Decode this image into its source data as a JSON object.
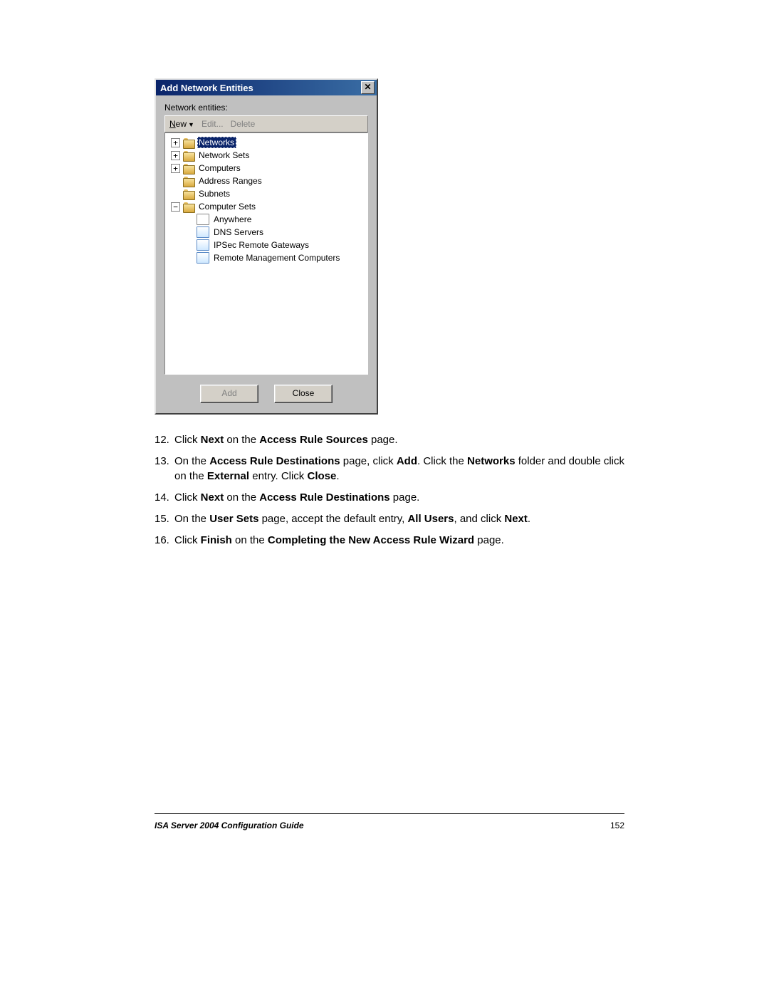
{
  "dialog": {
    "title": "Add Network Entities",
    "label": "Network entities:",
    "toolbar": {
      "new": "New",
      "edit": "Edit...",
      "delete": "Delete"
    },
    "tree": {
      "networks": "Networks",
      "network_sets": "Network Sets",
      "computers": "Computers",
      "address_ranges": "Address Ranges",
      "subnets": "Subnets",
      "computer_sets": "Computer Sets",
      "anywhere": "Anywhere",
      "dns_servers": "DNS Servers",
      "ipsec": "IPSec Remote Gateways",
      "remote_mgmt": "Remote Management Computers"
    },
    "buttons": {
      "add": "Add",
      "close": "Close"
    }
  },
  "steps": {
    "s12_num": "12.",
    "s12_a": "Click ",
    "s12_b": "Next",
    "s12_c": " on the ",
    "s12_d": "Access Rule Sources",
    "s12_e": " page.",
    "s13_num": "13.",
    "s13_a": "On the ",
    "s13_b": "Access Rule Destinations",
    "s13_c": " page, click ",
    "s13_d": "Add",
    "s13_e": ". Click the ",
    "s13_f": "Networks",
    "s13_g": " folder and double click on the ",
    "s13_h": "External",
    "s13_i": " entry. Click ",
    "s13_j": "Close",
    "s13_k": ".",
    "s14_num": "14.",
    "s14_a": "Click ",
    "s14_b": "Next",
    "s14_c": " on the ",
    "s14_d": "Access Rule Destinations",
    "s14_e": " page.",
    "s15_num": "15.",
    "s15_a": "On the ",
    "s15_b": "User Sets",
    "s15_c": " page, accept the default entry, ",
    "s15_d": "All Users",
    "s15_e": ", and click ",
    "s15_f": "Next",
    "s15_g": ".",
    "s16_num": "16.",
    "s16_a": "Click ",
    "s16_b": "Finish",
    "s16_c": " on the ",
    "s16_d": "Completing the New Access Rule Wizard",
    "s16_e": " page."
  },
  "footer": {
    "title": "ISA Server 2004 Configuration Guide",
    "page": "152"
  }
}
